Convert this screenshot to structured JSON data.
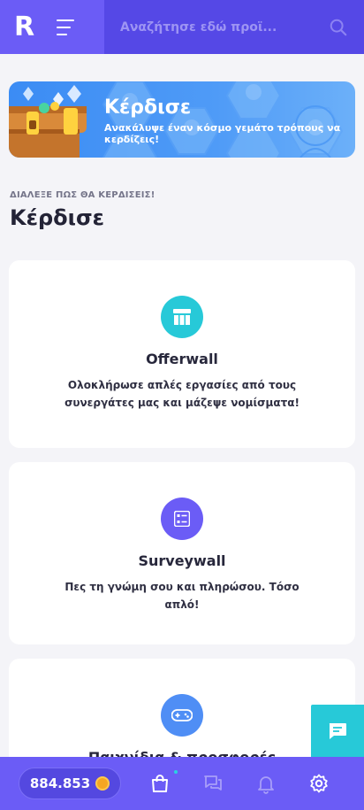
{
  "header": {
    "logo": "R",
    "search_placeholder": "Αναζήτησε εδώ προϊ..."
  },
  "banner": {
    "title": "Κέρδισε",
    "subtitle": "Ανακάλυψε έναν κόσμο γεμάτο τρόπους να κερδίζεις!"
  },
  "section": {
    "kicker": "ΔΙΑΛΕΞΕ ΠΩΣ ΘΑ ΚΕΡΔΙΣΕΙΣ!",
    "title": "Κέρδισε"
  },
  "cards": [
    {
      "title": "Offerwall",
      "description": "Ολοκλήρωσε απλές εργασίες από τους συνεργάτες μας και μάζεψε νομίσματα!",
      "icon": "offerwall-icon",
      "color": "#27c9d8"
    },
    {
      "title": "Surveywall",
      "description": "Πες τη γνώμη σου και πληρώσου. Τόσο απλό!",
      "icon": "survey-icon",
      "color": "#6b5cf6"
    },
    {
      "title": "Παιχνίδια & προσφορές",
      "description": "",
      "icon": "gamepad-icon",
      "color": "#4f8ef5"
    }
  ],
  "bottom_nav": {
    "balance": "884.853",
    "items": [
      "shop-icon",
      "chat-icon",
      "bell-icon",
      "settings-icon"
    ]
  },
  "colors": {
    "primary": "#6b5cf6",
    "primary_dark": "#5548e6",
    "accent_cyan": "#27c9d8",
    "banner_blue": "#3b8cf4"
  }
}
